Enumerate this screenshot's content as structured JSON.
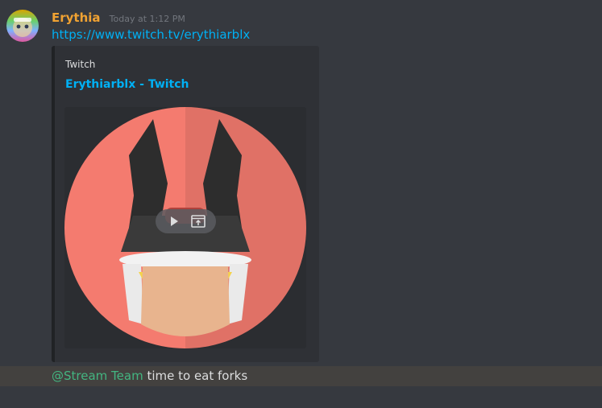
{
  "message1": {
    "author": "Erythia",
    "timestamp": "Today at 1:12 PM",
    "link": "https://www.twitch.tv/erythiarblx",
    "embed": {
      "provider": "Twitch",
      "title": "Erythiarblx - Twitch"
    }
  },
  "message2": {
    "mention": "@Stream Team",
    "text": " time to eat forks"
  },
  "colors": {
    "background": "#36393f",
    "username": "#f0a232",
    "link": "#00b0f4",
    "mention": "#43b581",
    "highlight_row": "#43413f",
    "thumbnail_circle": "#f47b6f"
  },
  "icons": [
    "avatar-image",
    "play-icon",
    "popout-icon"
  ]
}
